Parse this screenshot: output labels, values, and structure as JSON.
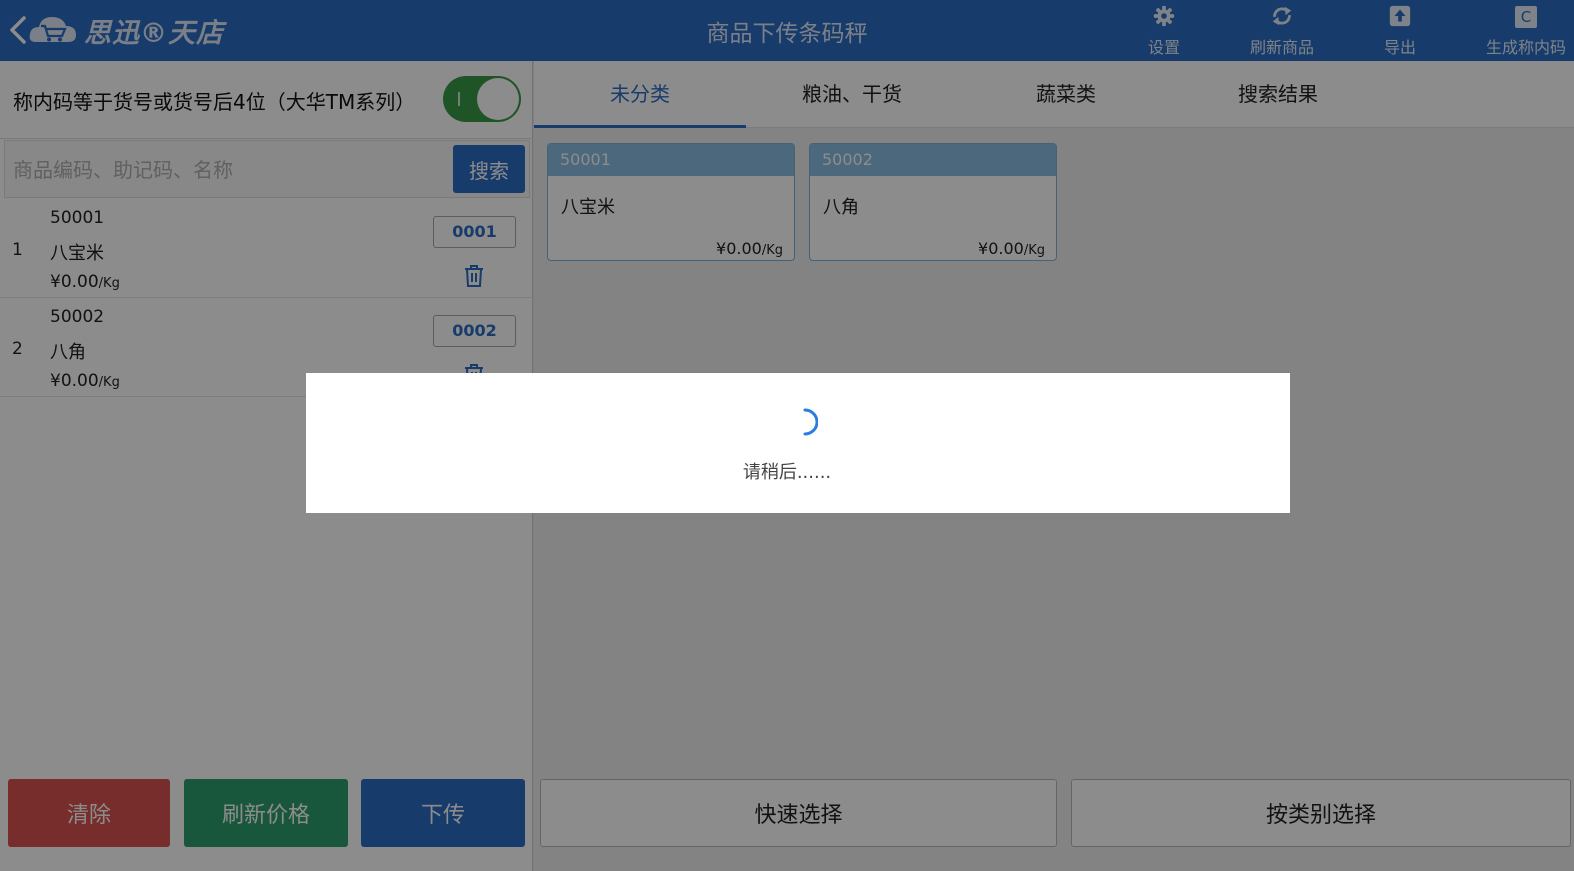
{
  "header": {
    "logo_text": "思迅®天店",
    "title": "商品下传条码秤",
    "actions": [
      {
        "label": "设置",
        "icon": "gear-icon"
      },
      {
        "label": "刷新商品",
        "icon": "refresh-icon"
      },
      {
        "label": "导出",
        "icon": "export-icon"
      },
      {
        "label": "生成称内码",
        "icon": "c-icon"
      }
    ],
    "c_glyph": "C"
  },
  "left": {
    "toggle_label": "称内码等于货号或货号后4位（大华TM系列）",
    "toggle_on": true,
    "search": {
      "placeholder": "商品编码、助记码、名称",
      "value": "",
      "button": "搜索"
    },
    "items": [
      {
        "index": "1",
        "code": "50001",
        "name": "八宝米",
        "price": "¥0.00",
        "unit": "/Kg",
        "plu": "0001"
      },
      {
        "index": "2",
        "code": "50002",
        "name": "八角",
        "price": "¥0.00",
        "unit": "/Kg",
        "plu": "0002"
      }
    ],
    "buttons": {
      "clear": "清除",
      "refresh_price": "刷新价格",
      "download": "下传"
    }
  },
  "right": {
    "tabs": [
      "未分类",
      "粮油、干货",
      "蔬菜类",
      "搜索结果"
    ],
    "active_tab": 0,
    "cards": [
      {
        "code": "50001",
        "name": "八宝米",
        "price": "¥0.00",
        "unit": "/Kg"
      },
      {
        "code": "50002",
        "name": "八角",
        "price": "¥0.00",
        "unit": "/Kg"
      }
    ],
    "buttons": {
      "quick_select": "快速选择",
      "by_category": "按类别选择"
    }
  },
  "loading": {
    "text": "请稍后......"
  },
  "colors": {
    "primary": "#2b6cc4",
    "clear": "#d9534f",
    "refresh": "#2f9e6d",
    "toggle_on": "#3a9a47"
  }
}
